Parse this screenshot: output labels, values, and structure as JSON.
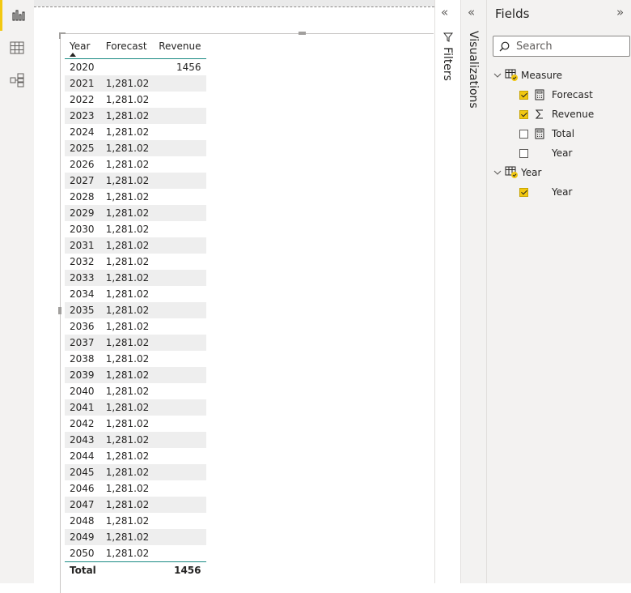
{
  "table": {
    "headers": [
      "Year",
      "Forecast",
      "Revenue"
    ],
    "rows": [
      {
        "year": "2020",
        "forecast": "",
        "revenue": "1456"
      },
      {
        "year": "2021",
        "forecast": "1,281.02",
        "revenue": ""
      },
      {
        "year": "2022",
        "forecast": "1,281.02",
        "revenue": ""
      },
      {
        "year": "2023",
        "forecast": "1,281.02",
        "revenue": ""
      },
      {
        "year": "2024",
        "forecast": "1,281.02",
        "revenue": ""
      },
      {
        "year": "2025",
        "forecast": "1,281.02",
        "revenue": ""
      },
      {
        "year": "2026",
        "forecast": "1,281.02",
        "revenue": ""
      },
      {
        "year": "2027",
        "forecast": "1,281.02",
        "revenue": ""
      },
      {
        "year": "2028",
        "forecast": "1,281.02",
        "revenue": ""
      },
      {
        "year": "2029",
        "forecast": "1,281.02",
        "revenue": ""
      },
      {
        "year": "2030",
        "forecast": "1,281.02",
        "revenue": ""
      },
      {
        "year": "2031",
        "forecast": "1,281.02",
        "revenue": ""
      },
      {
        "year": "2032",
        "forecast": "1,281.02",
        "revenue": ""
      },
      {
        "year": "2033",
        "forecast": "1,281.02",
        "revenue": ""
      },
      {
        "year": "2034",
        "forecast": "1,281.02",
        "revenue": ""
      },
      {
        "year": "2035",
        "forecast": "1,281.02",
        "revenue": ""
      },
      {
        "year": "2036",
        "forecast": "1,281.02",
        "revenue": ""
      },
      {
        "year": "2037",
        "forecast": "1,281.02",
        "revenue": ""
      },
      {
        "year": "2038",
        "forecast": "1,281.02",
        "revenue": ""
      },
      {
        "year": "2039",
        "forecast": "1,281.02",
        "revenue": ""
      },
      {
        "year": "2040",
        "forecast": "1,281.02",
        "revenue": ""
      },
      {
        "year": "2041",
        "forecast": "1,281.02",
        "revenue": ""
      },
      {
        "year": "2042",
        "forecast": "1,281.02",
        "revenue": ""
      },
      {
        "year": "2043",
        "forecast": "1,281.02",
        "revenue": ""
      },
      {
        "year": "2044",
        "forecast": "1,281.02",
        "revenue": ""
      },
      {
        "year": "2045",
        "forecast": "1,281.02",
        "revenue": ""
      },
      {
        "year": "2046",
        "forecast": "1,281.02",
        "revenue": ""
      },
      {
        "year": "2047",
        "forecast": "1,281.02",
        "revenue": ""
      },
      {
        "year": "2048",
        "forecast": "1,281.02",
        "revenue": ""
      },
      {
        "year": "2049",
        "forecast": "1,281.02",
        "revenue": ""
      },
      {
        "year": "2050",
        "forecast": "1,281.02",
        "revenue": ""
      }
    ],
    "total": {
      "label": "Total",
      "forecast": "",
      "revenue": "1456"
    }
  },
  "panes": {
    "filters_label": "Filters",
    "visualizations_label": "Visualizations",
    "fields_title": "Fields"
  },
  "fields": {
    "search_placeholder": "Search",
    "tables": [
      {
        "name": "Measure",
        "items": [
          {
            "label": "Forecast",
            "checked": true,
            "icon": "calculator-icon"
          },
          {
            "label": "Revenue",
            "checked": true,
            "icon": "sigma-icon"
          },
          {
            "label": "Total",
            "checked": false,
            "icon": "calculator-icon"
          },
          {
            "label": "Year",
            "checked": false,
            "icon": ""
          }
        ]
      },
      {
        "name": "Year",
        "items": [
          {
            "label": "Year",
            "checked": true,
            "icon": ""
          }
        ]
      }
    ]
  },
  "colors": {
    "accent": "#f2c811",
    "header_rule": "#1a8a84",
    "alt_row": "#eeeeee"
  },
  "icons": {
    "rail": [
      "report-icon",
      "data-icon",
      "model-icon"
    ]
  }
}
